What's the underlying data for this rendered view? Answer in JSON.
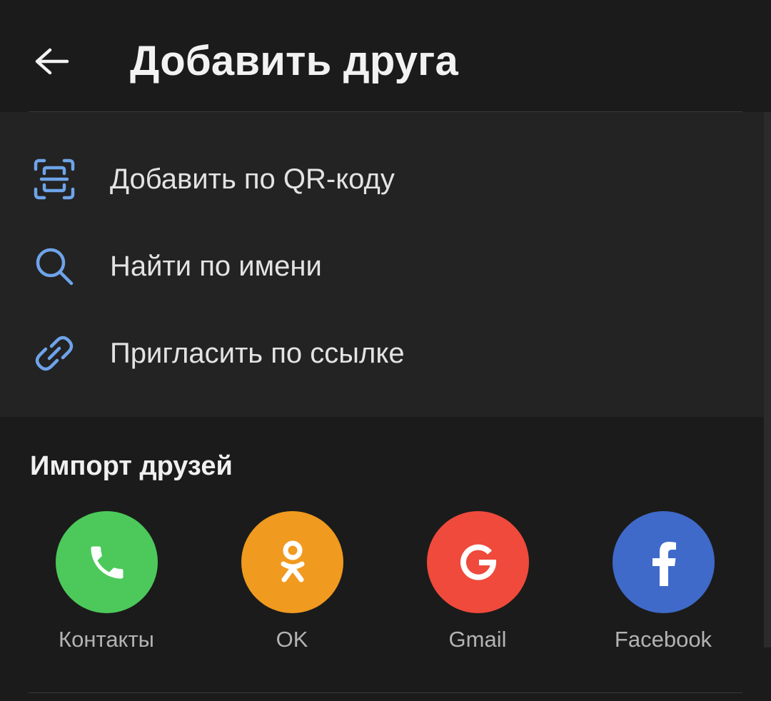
{
  "header": {
    "title": "Добавить друга",
    "back_icon": "arrow-left-icon"
  },
  "actions": [
    {
      "label": "Добавить по QR-коду",
      "icon": "qr-scan-icon"
    },
    {
      "label": "Найти по имени",
      "icon": "search-icon"
    },
    {
      "label": "Пригласить по ссылке",
      "icon": "link-icon"
    }
  ],
  "import": {
    "title": "Импорт друзей",
    "items": [
      {
        "label": "Контакты",
        "icon": "phone-icon",
        "color": "#4cc95a"
      },
      {
        "label": "OK",
        "icon": "odnoklassniki-icon",
        "color": "#f09a1f"
      },
      {
        "label": "Gmail",
        "icon": "google-icon",
        "color": "#ef4a3c"
      },
      {
        "label": "Facebook",
        "icon": "facebook-icon",
        "color": "#3f6ac9"
      }
    ]
  },
  "colors": {
    "background": "#1b1b1b",
    "actions_background": "#232323",
    "accent_icon": "#6ea4ea",
    "text_primary": "#e3e3e3",
    "text_secondary": "#b3b3b3"
  }
}
